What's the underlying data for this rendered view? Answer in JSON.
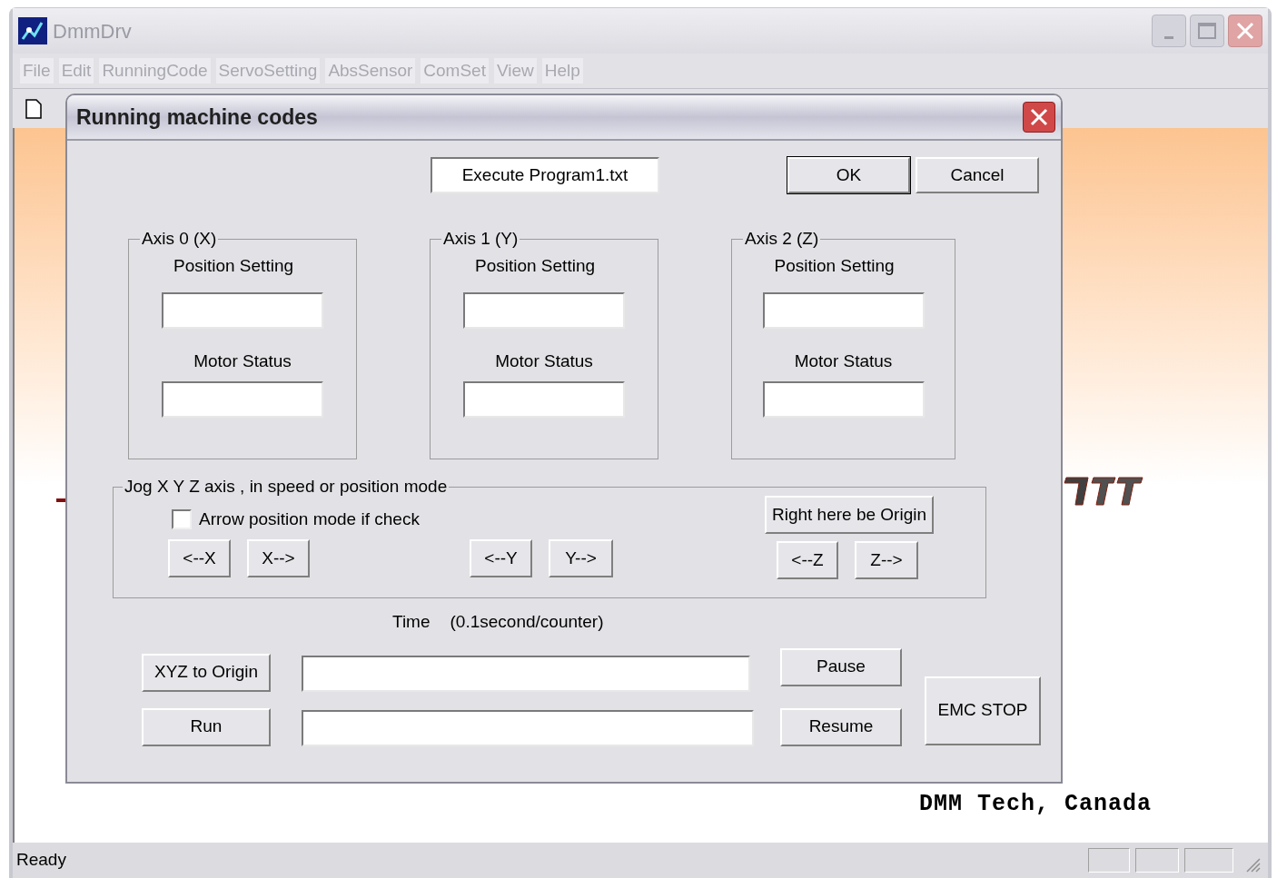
{
  "window": {
    "title": "DmmDrv"
  },
  "menu": [
    "File",
    "Edit",
    "RunningCode",
    "ServoSetting",
    "AbsSensor",
    "ComSet",
    "View",
    "Help"
  ],
  "dialog": {
    "title": "Running machine codes",
    "program_field": {
      "value": "Execute Program1.txt"
    },
    "ok": "OK",
    "cancel": "Cancel",
    "axes": [
      {
        "title": "Axis 0 (X)",
        "position_label": "Position Setting",
        "status_label": "Motor Status"
      },
      {
        "title": "Axis 1 (Y)",
        "position_label": "Position Setting",
        "status_label": "Motor Status"
      },
      {
        "title": "Axis 2 (Z)",
        "position_label": "Position Setting",
        "status_label": "Motor Status"
      }
    ],
    "jog": {
      "title": "Jog X Y Z axis , in speed or position mode",
      "checkbox": {
        "label": "Arrow position mode if check",
        "checked": false
      },
      "origin_button": "Right here be Origin",
      "buttons": [
        "<--X",
        "X-->",
        "<--Y",
        "Y-->",
        "<--Z",
        "Z-->"
      ]
    },
    "time_label": "Time",
    "time_unit": "(0.1second/counter)",
    "xyz_origin": "XYZ to Origin",
    "run": "Run",
    "pause": "Pause",
    "resume": "Resume",
    "emc_stop": "EMC STOP"
  },
  "background_text": "DMM Tech, Canada",
  "status_bar": {
    "text": "Ready"
  }
}
